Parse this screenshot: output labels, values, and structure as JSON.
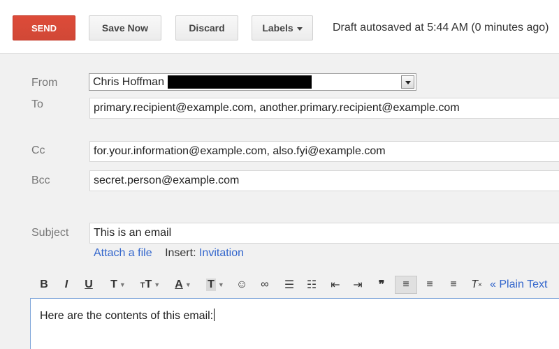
{
  "toolbar": {
    "send_label": "SEND",
    "save_label": "Save Now",
    "discard_label": "Discard",
    "labels_label": "Labels",
    "autosave_text": "Draft autosaved at 5:44 AM (0 minutes ago)"
  },
  "compose": {
    "from": {
      "label": "From",
      "value": "Chris Hoffman"
    },
    "to": {
      "label": "To",
      "value": "primary.recipient@example.com, another.primary.recipient@example.com"
    },
    "cc": {
      "label": "Cc",
      "value": "for.your.information@example.com, also.fyi@example.com"
    },
    "bcc": {
      "label": "Bcc",
      "value": "secret.person@example.com"
    },
    "subject": {
      "label": "Subject",
      "value": "This is an email"
    },
    "attach_label": "Attach a file",
    "insert_label": "Insert:",
    "invitation_label": "Invitation",
    "body": "Here are the contents of this email:"
  },
  "format_toolbar": {
    "plain_text_label": "« Plain Text",
    "icons": [
      "bold-icon",
      "italic-icon",
      "underline-icon",
      "font-icon",
      "font-size-icon",
      "text-color-icon",
      "highlight-color-icon",
      "emoji-icon",
      "link-icon",
      "numbered-list-icon",
      "bulleted-list-icon",
      "indent-less-icon",
      "indent-more-icon",
      "quote-icon",
      "align-left-icon",
      "align-center-icon",
      "align-right-icon",
      "remove-formatting-icon"
    ]
  },
  "colors": {
    "send_button": "#d14836",
    "link": "#3366cc",
    "form_background": "#f1f1f1",
    "body_border": "#7fa6d9"
  }
}
